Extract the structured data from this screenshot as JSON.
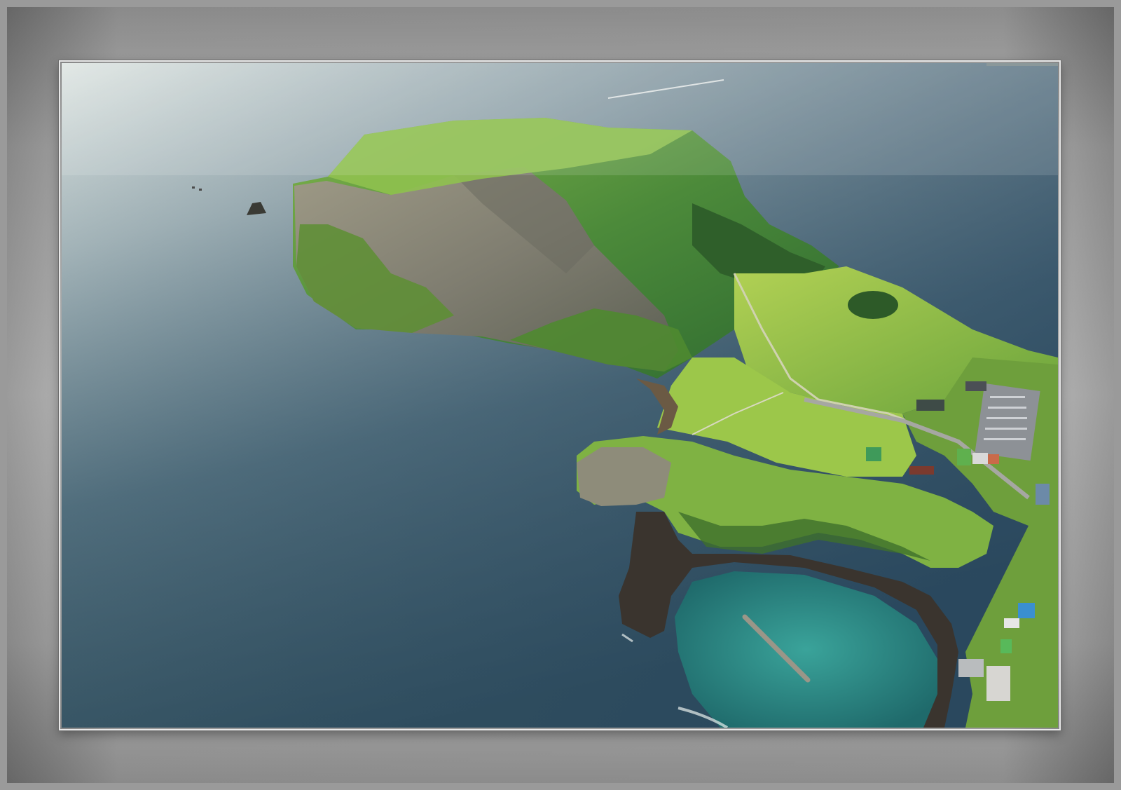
{
  "image": {
    "subject": "aerial-coastal-headland",
    "colors": {
      "frame": "#9a9a9a",
      "sea_light": "#c9d6d7",
      "sea_deep": "#3b5a66",
      "grass": "#6fa83a",
      "grass_light": "#a9cc4a",
      "cliff": "#8c8a7c",
      "lagoon": "#2c8f8a"
    }
  }
}
